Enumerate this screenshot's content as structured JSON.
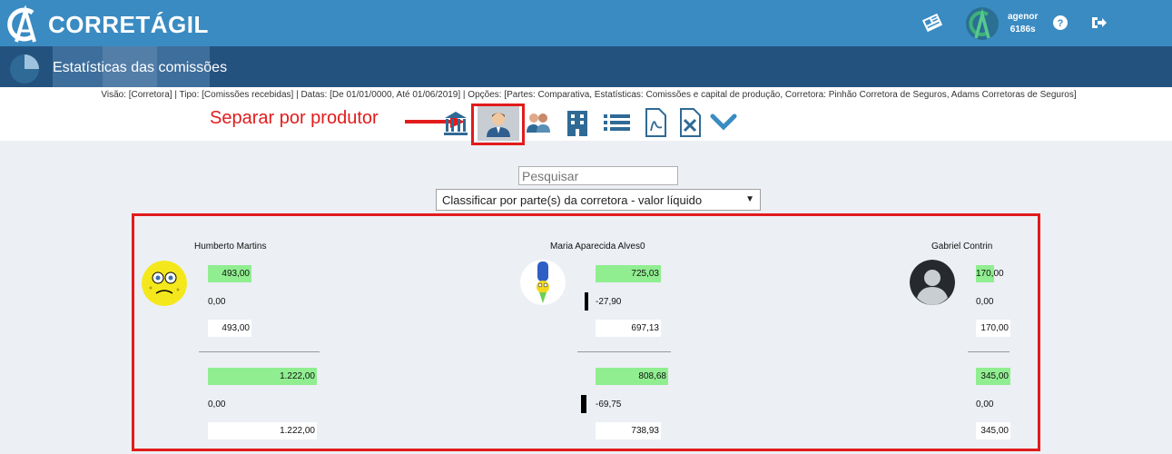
{
  "app": {
    "brand": "CORRETÁGIL"
  },
  "user": {
    "name": "agenor",
    "code": "6186s"
  },
  "page": {
    "title": "Estatísticas das comissões"
  },
  "filters": "Visão: [Corretora] | Tipo: [Comissões recebidas] | Datas: [De 01/01/0000, Até 01/06/2019] | Opções: [Partes: Comparativa, Estatísticas: Comissões e capital de produção, Corretora: Pinhão Corretora de Seguros, Adams Corretoras de Seguros]",
  "annotation": "Separar por produtor",
  "search": {
    "placeholder": "Pesquisar"
  },
  "sort": {
    "selected": "Classificar por parte(s) da corretora - valor líquido"
  },
  "producers": [
    {
      "name": "Humberto Martins",
      "v1": "493,00",
      "v2": "0,00",
      "v3": "493,00",
      "v4": "1.222,00",
      "v5": "0,00",
      "v6": "1.222,00"
    },
    {
      "name": "Maria Aparecida Alves0",
      "v1": "725,03",
      "v2": "-27,90",
      "v3": "697,13",
      "v4": "808,68",
      "v5": "-69,75",
      "v6": "738,93"
    },
    {
      "name": "Gabriel Contrin",
      "v1": "170,00",
      "v2": "0,00",
      "v3": "170,00",
      "v4": "345,00",
      "v5": "0,00",
      "v6": "345,00"
    }
  ],
  "colors": {
    "topbar": "#3a8bc2",
    "titlebar": "#24527e",
    "accent": "#e21b1b",
    "positive": "#90ee90"
  },
  "icons": [
    "bank-icon",
    "producer-icon",
    "group-icon",
    "building-icon",
    "list-icon",
    "pdf-icon",
    "excel-icon",
    "chevron-down-icon"
  ]
}
